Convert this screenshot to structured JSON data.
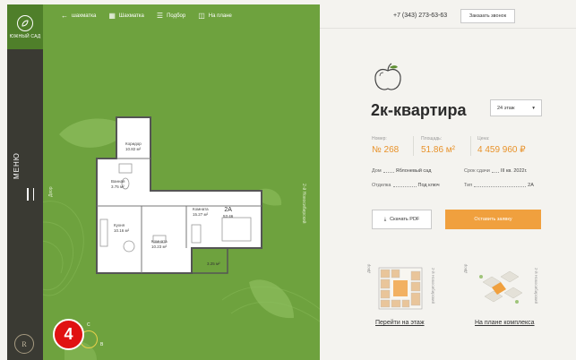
{
  "sidebar": {
    "logo_text": "ЮЖНЫЙ САД",
    "menu_label": "МЕНЮ",
    "seal_letter": "R"
  },
  "topnav": {
    "items": [
      {
        "label": "шахматка",
        "icon": "arrow-left-icon"
      },
      {
        "label": "Шахматка",
        "icon": "grid-icon"
      },
      {
        "label": "Подбор",
        "icon": "filter-icon"
      },
      {
        "label": "На плане",
        "icon": "map-icon"
      }
    ]
  },
  "plan": {
    "left_label": "Двор",
    "right_label": "2-й Новосибирский",
    "rooms": [
      {
        "name": "Коридор",
        "area": "10.82 м²"
      },
      {
        "name": "Ванная",
        "area": "3.75 м²"
      },
      {
        "name": "Кухня",
        "area": "10.16 м²"
      },
      {
        "name": "Комната",
        "area": "10.23 м²"
      },
      {
        "name": "Комната",
        "area": "15.27 м²"
      },
      {
        "name": "2А",
        "area": "53.46"
      },
      {
        "name": "",
        "area": "3.25 м²"
      }
    ],
    "compass_n": "С",
    "compass_e": "В",
    "badge": "4"
  },
  "header": {
    "phone": "+7 (343) 273-63-63",
    "call_button": "Заказать звонок"
  },
  "apartment": {
    "title": "2к-квартира",
    "floor_select": "24 этаж",
    "stats": [
      {
        "label": "Номер:",
        "value": "№ 268"
      },
      {
        "label": "Площадь:",
        "value": "51.86 м²"
      },
      {
        "label": "Цена:",
        "value": "4 459 960 ₽"
      }
    ],
    "details": [
      {
        "key": "Дом",
        "value": "Яблоневый сад"
      },
      {
        "key": "Срок сдачи",
        "value": "III кв. 2022г."
      },
      {
        "key": "Отделка",
        "value": "Под ключ"
      },
      {
        "key": "Тип",
        "value": "2А"
      }
    ],
    "pdf_button": "Скачать PDF",
    "apply_button": "Оставить заявку"
  },
  "bottom": {
    "floor_link": "Перейти на этаж",
    "complex_link": "На плане комплекса",
    "floor_side_left": "Двор",
    "floor_side_right": "2-й Новосибирский",
    "complex_side_left": "Двор",
    "complex_side_right": "2-й Новосибирский"
  },
  "colors": {
    "green": "#6ea23e",
    "sidebar": "#3a3a33",
    "orange": "#e8922a",
    "button_orange": "#f0a03e",
    "badge_red": "#e01212"
  }
}
